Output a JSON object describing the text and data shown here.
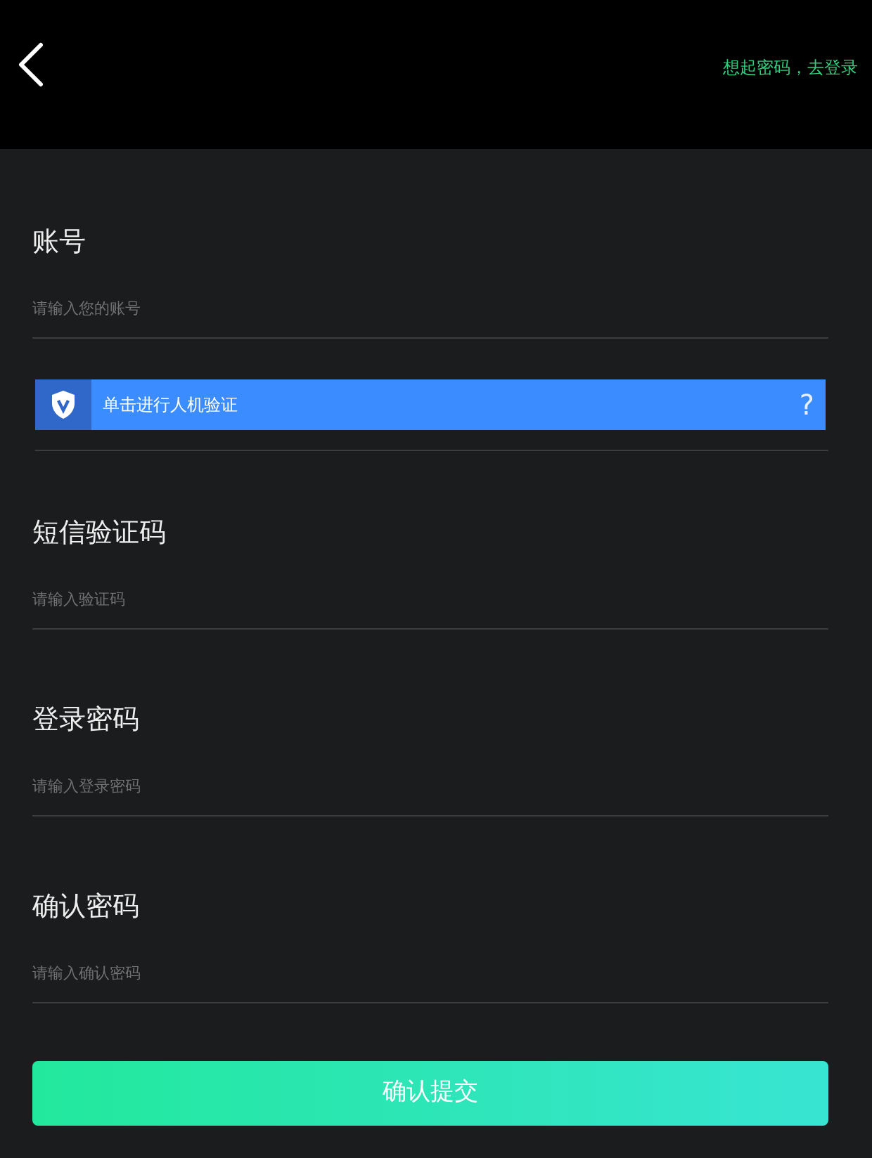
{
  "header": {
    "login_link": "想起密码，去登录"
  },
  "items": [
    {
      "kind": "field",
      "label": "账号",
      "placeholder": "请输入您的账号"
    },
    {
      "kind": "captcha",
      "text": "单击进行人机验证",
      "help": "?"
    },
    {
      "kind": "field",
      "label": "短信验证码",
      "placeholder": "请输入验证码"
    },
    {
      "kind": "field",
      "label": "登录密码",
      "placeholder": "请输入登录密码"
    },
    {
      "kind": "field",
      "label": "确认密码",
      "placeholder": "请输入确认密码"
    }
  ],
  "submit": "确认提交"
}
